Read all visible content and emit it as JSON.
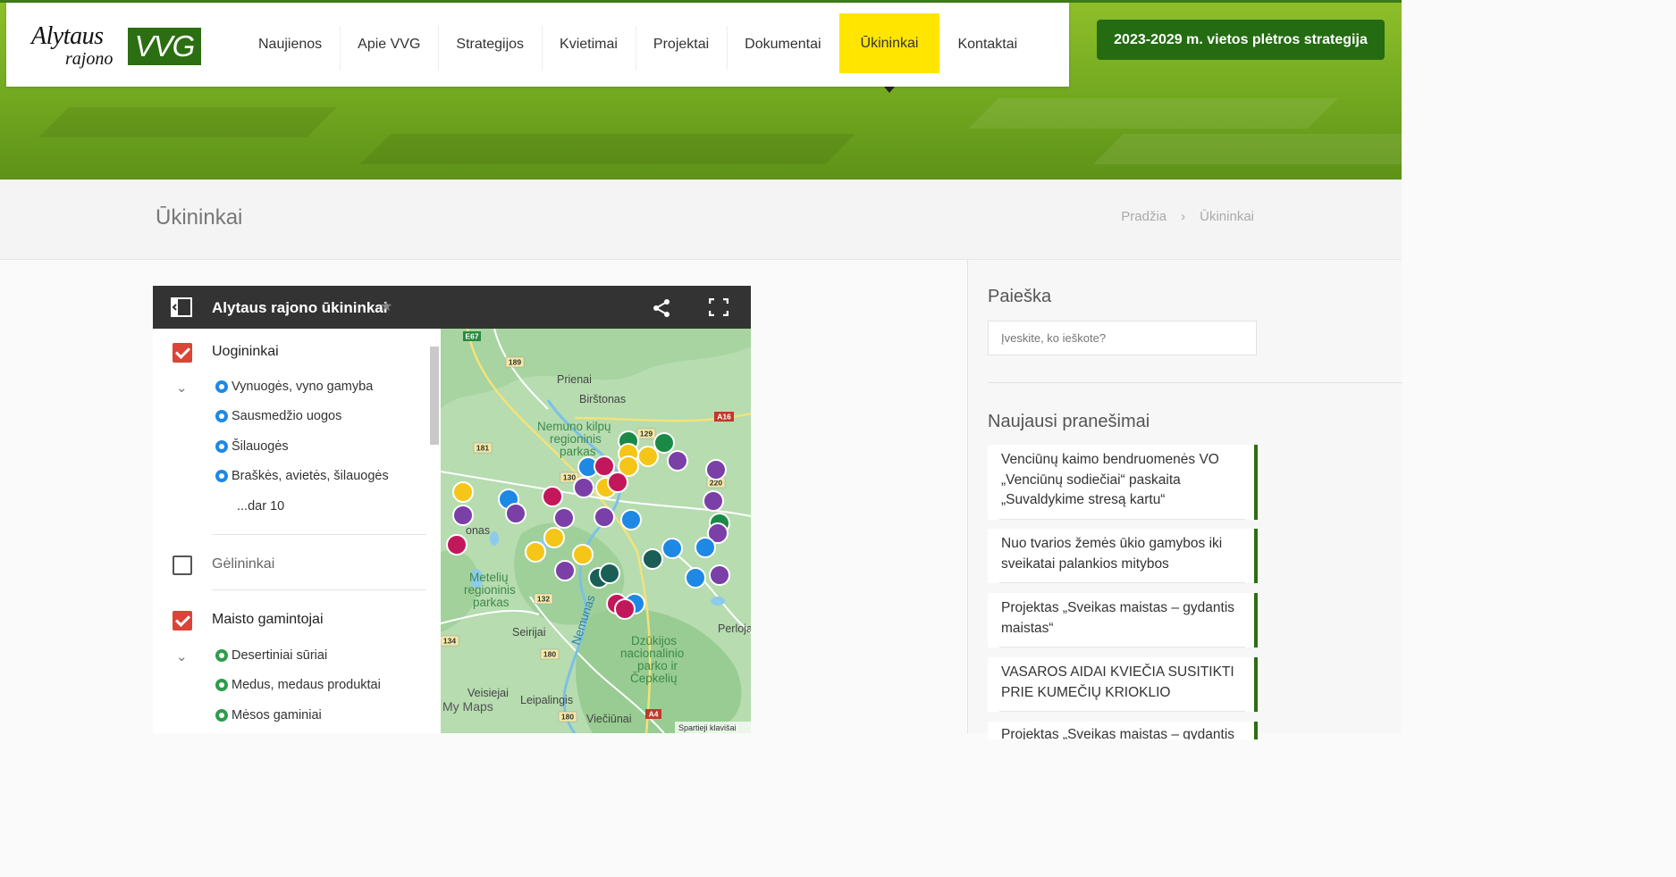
{
  "header": {
    "logo": {
      "line1": "Alytaus",
      "line2": "rajono",
      "badge": "VVG"
    },
    "nav": [
      "Naujienos",
      "Apie VVG",
      "Strategijos",
      "Kvietimai",
      "Projektai",
      "Dokumentai",
      "Ūkininkai",
      "Kontaktai"
    ],
    "active_nav": "Ūkininkai",
    "cta_label": "2023-2029 m. vietos plėtros strategija"
  },
  "page": {
    "title": "Ūkininkai",
    "breadcrumb": {
      "home": "Pradžia",
      "separator": "›",
      "current": "Ūkininkai"
    }
  },
  "map": {
    "title": "Alytaus rajono ūkininkai",
    "legend": {
      "cat1": {
        "label": "Uogininkai",
        "checked": true,
        "items": [
          "Vynuogės, vyno gamyba",
          "Sausmedžio uogos",
          "Šilauogės",
          "Braškės, avietės, šilauogės"
        ],
        "more": "...dar 10"
      },
      "cat2": {
        "label": "Gėlininkai",
        "checked": false
      },
      "cat3": {
        "label": "Maisto gamintojai",
        "checked": true,
        "items": [
          "Desertiniai sūriai",
          "Medus, medaus produktai",
          "Mėsos gaminiai"
        ]
      }
    },
    "labels": {
      "prienai": "Prienai",
      "birstonas": "Birštonas",
      "nemuno": "Nemuno kilpų regioninis parkas",
      "metelai": "Metelių regioninis parkas",
      "dzukijos": "Dzūkijos nacionalinio parko ir Čepkelių",
      "seirijai": "Seirijai",
      "veisiejai": "Veisiejai",
      "leipalingis": "Leipalingis",
      "vieciunai": "Viečiūnai",
      "perloja": "Perloja",
      "nemunas": "Nemunas",
      "onas": "onas",
      "mymaps": "My Maps",
      "shortcuts": "Spartieji klavišai",
      "roads": [
        "E67",
        "189",
        "A16",
        "181",
        "129",
        "130",
        "220",
        "132",
        "134",
        "180",
        "180",
        "A4"
      ]
    }
  },
  "sidebar": {
    "search_heading": "Paieška",
    "search_placeholder": "Įveskite, ko ieškote?",
    "news_heading": "Naujausi pranešimai",
    "posts": [
      "Venciūnų kaimo bendruomenės VO „Venciūnų sodiečiai“ paskaita „Suvaldykime stresą kartu“",
      "Nuo tvarios žemės ūkio gamybos iki sveikatai palankios mitybos",
      "Projektas „Sveikas maistas – gydantis maistas“",
      "VASAROS AIDAI KVIEČIA SUSITIKTI PRIE KUMEČIŲ KRIOKLIO",
      "Projektas „Sveikas maistas – gydantis maistas“"
    ]
  },
  "colors": {
    "accent": "#246b12",
    "active_nav": "#ffe500",
    "checkbox": "#db4437"
  }
}
